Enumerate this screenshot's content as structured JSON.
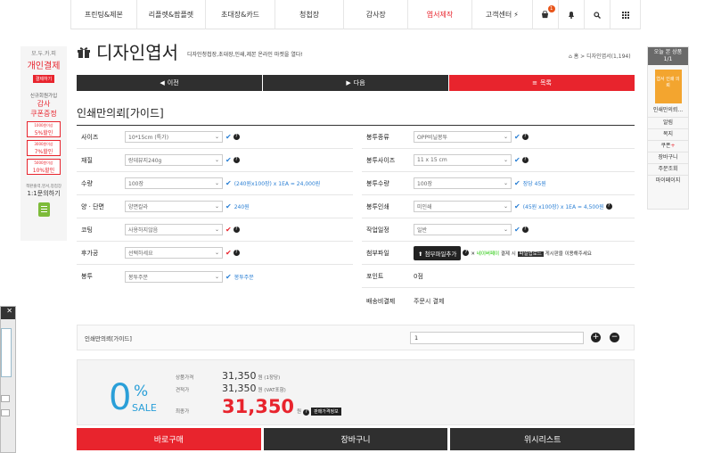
{
  "nav": {
    "items": [
      "프린팅&제본",
      "리플렛&팜플렛",
      "초대장&카드",
      "청첩장",
      "감사장",
      "엽서제작",
      "고객센터"
    ],
    "cart_count": "1"
  },
  "left": {
    "l1": "모.두.카.피",
    "l2": "개인결제",
    "l3": "결제하기",
    "l4": "신규회원가입",
    "l5": "감사",
    "l6": "쿠폰증정",
    "c1t": "1000원이상",
    "c1": "5%할인",
    "c2t": "3000원이상",
    "c2": "7%할인",
    "c3t": "5000원이상",
    "c3": "10%할인",
    "l7": "책판출력,영서,청첩장",
    "l8": "1:1문의하기"
  },
  "right": {
    "head1": "오늘 본 상품",
    "head2": "1/1",
    "thumb": "엽서 인쇄 의뢰",
    "pname": "인쇄만의뢰...",
    "items": [
      "알림",
      "목지",
      "쿠폰",
      "장바구니",
      "주문조회",
      "마이페이지"
    ]
  },
  "title": {
    "main": "디자인엽서",
    "sub": "디자인청첩장,초대장,인쇄,제본 온라인 마켓을 열다!",
    "crumb": "홈 > 디자인엽서(1,194)"
  },
  "navbtns": {
    "prev": "이전",
    "next": "다음",
    "list": "목록"
  },
  "section": "인쇄만의뢰[가이드]",
  "left_form": [
    {
      "label": "사이즈",
      "value": "10*15cm (특가)"
    },
    {
      "label": "재질",
      "value": "랑데뷰지240g"
    },
    {
      "label": "수량",
      "value": "100장",
      "note": "(240원x100장) x 1EA = 24,000원"
    },
    {
      "label": "양 · 단면",
      "value": "양면칼라",
      "note": "240원"
    },
    {
      "label": "코팅",
      "value": "사용하지않음"
    },
    {
      "label": "후가공",
      "value": "선택하세요"
    },
    {
      "label": "봉투",
      "value": "봉투주문",
      "note": "봉투주문"
    }
  ],
  "right_form": [
    {
      "label": "봉투종류",
      "value": "OPP비닐봉투"
    },
    {
      "label": "봉투사이즈",
      "value": "11 x 15 cm"
    },
    {
      "label": "봉투수량",
      "value": "100장",
      "note": "장당 45원"
    },
    {
      "label": "봉투인쇄",
      "value": "미인쇄",
      "note": "(45원 x100장) x 1EA = 4,500원"
    },
    {
      "label": "작업일정",
      "value": "일반"
    },
    {
      "label": "첨부파일",
      "btn": "첨부파일추가",
      "n1": "네이버페이",
      "n2": "결제 시",
      "n3": "파일업로드",
      "n4": "게시판을 이용해주세요"
    },
    {
      "label": "포인트",
      "value": "0점"
    },
    {
      "label": "배송비결제",
      "value": "주문시 결제"
    }
  ],
  "qty": {
    "label": "인쇄만의뢰[가이드]",
    "value": "1"
  },
  "price": {
    "pct": "0",
    "pct_sym": "%",
    "sale": "SALE",
    "l1": "상품가격",
    "v1": "31,350",
    "u1": "원 (1장당)",
    "l2": "견적가",
    "v2": "31,350",
    "u2": "원 (VAT포함)",
    "l3": "최종가",
    "v3": "31,350",
    "u3": "원",
    "tip": "판매가격정보"
  },
  "buttons": {
    "buy": "바로구매",
    "cart": "장바구니",
    "wish": "위시리스트"
  }
}
